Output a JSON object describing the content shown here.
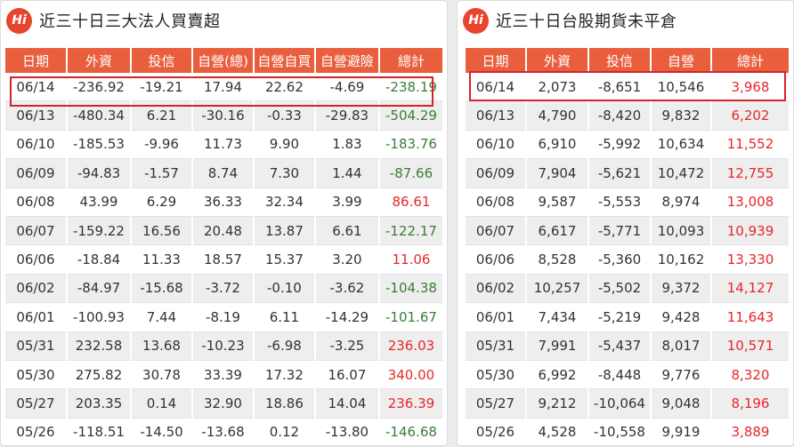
{
  "left": {
    "logo": "Hi",
    "title": "近三十日三大法人買賣超",
    "headers": [
      "日期",
      "外資",
      "投信",
      "自營(總)",
      "自營自買",
      "自營避險",
      "總計"
    ],
    "rows": [
      [
        "06/14",
        "-236.92",
        "-19.21",
        "17.94",
        "22.62",
        "-4.69",
        "-238.19"
      ],
      [
        "06/13",
        "-480.34",
        "6.21",
        "-30.16",
        "-0.33",
        "-29.83",
        "-504.29"
      ],
      [
        "06/10",
        "-185.53",
        "-9.96",
        "11.73",
        "9.90",
        "1.83",
        "-183.76"
      ],
      [
        "06/09",
        "-94.83",
        "-1.57",
        "8.74",
        "7.30",
        "1.44",
        "-87.66"
      ],
      [
        "06/08",
        "43.99",
        "6.29",
        "36.33",
        "32.34",
        "3.99",
        "86.61"
      ],
      [
        "06/07",
        "-159.22",
        "16.56",
        "20.48",
        "13.87",
        "6.61",
        "-122.17"
      ],
      [
        "06/06",
        "-18.84",
        "11.33",
        "18.57",
        "15.37",
        "3.20",
        "11.06"
      ],
      [
        "06/02",
        "-84.97",
        "-15.68",
        "-3.72",
        "-0.10",
        "-3.62",
        "-104.38"
      ],
      [
        "06/01",
        "-100.93",
        "7.44",
        "-8.19",
        "6.11",
        "-14.29",
        "-101.67"
      ],
      [
        "05/31",
        "232.58",
        "13.68",
        "-10.23",
        "-6.98",
        "-3.25",
        "236.03"
      ],
      [
        "05/30",
        "275.82",
        "30.78",
        "33.39",
        "17.32",
        "16.07",
        "340.00"
      ],
      [
        "05/27",
        "203.35",
        "0.14",
        "32.90",
        "18.86",
        "14.04",
        "236.39"
      ],
      [
        "05/26",
        "-118.51",
        "-14.50",
        "-13.68",
        "0.12",
        "-13.80",
        "-146.68"
      ]
    ]
  },
  "right": {
    "logo": "Hi",
    "title": "近三十日台股期貨未平倉",
    "headers": [
      "日期",
      "外資",
      "投信",
      "自營",
      "總計"
    ],
    "rows": [
      [
        "06/14",
        "2,073",
        "-8,651",
        "10,546",
        "3,968"
      ],
      [
        "06/13",
        "4,790",
        "-8,420",
        "9,832",
        "6,202"
      ],
      [
        "06/10",
        "6,910",
        "-5,992",
        "10,634",
        "11,552"
      ],
      [
        "06/09",
        "7,904",
        "-5,621",
        "10,472",
        "12,755"
      ],
      [
        "06/08",
        "9,587",
        "-5,553",
        "8,974",
        "13,008"
      ],
      [
        "06/07",
        "6,617",
        "-5,771",
        "10,093",
        "10,939"
      ],
      [
        "06/06",
        "8,528",
        "-5,360",
        "10,162",
        "13,330"
      ],
      [
        "06/02",
        "10,257",
        "-5,502",
        "9,372",
        "14,127"
      ],
      [
        "06/01",
        "7,434",
        "-5,219",
        "9,428",
        "11,643"
      ],
      [
        "05/31",
        "7,991",
        "-5,437",
        "8,017",
        "10,571"
      ],
      [
        "05/30",
        "6,992",
        "-8,448",
        "9,776",
        "8,320"
      ],
      [
        "05/27",
        "9,212",
        "-10,064",
        "9,048",
        "8,196"
      ],
      [
        "05/26",
        "4,528",
        "-10,558",
        "9,919",
        "3,889"
      ]
    ]
  },
  "colors": {
    "header_bg": "#e95f3d",
    "positive": "#e8262b",
    "negative": "#3a7d36",
    "highlight": "#d6222a"
  }
}
